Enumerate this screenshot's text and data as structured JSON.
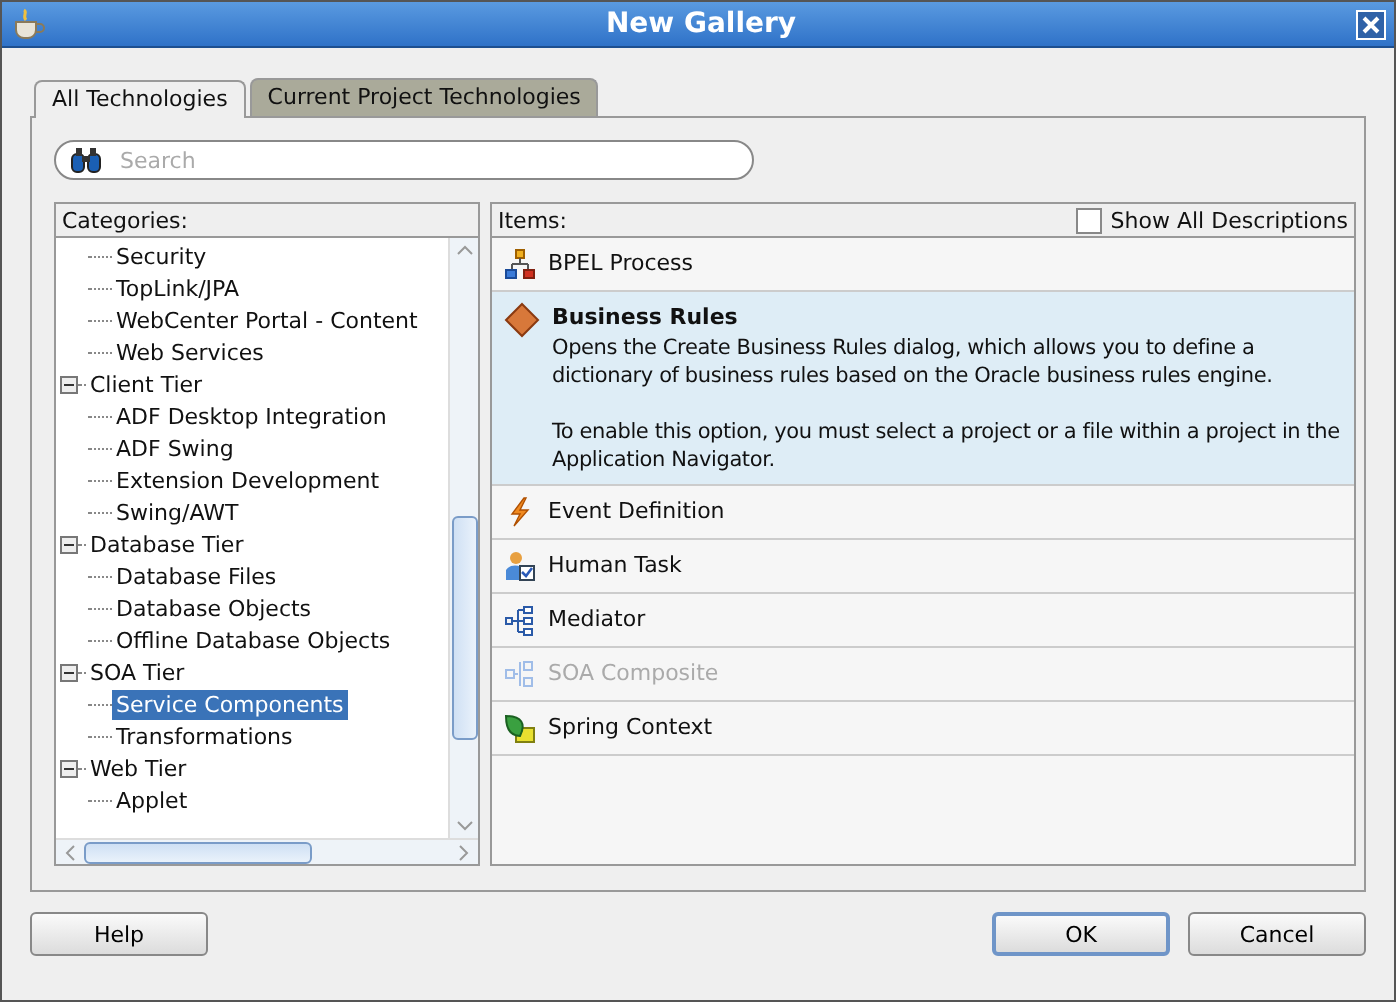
{
  "window": {
    "title": "New Gallery"
  },
  "tabs": [
    {
      "label": "All Technologies",
      "selected": true
    },
    {
      "label": "Current Project Technologies",
      "selected": false
    }
  ],
  "search": {
    "placeholder": "Search"
  },
  "categories": {
    "label": "Categories:",
    "tree": [
      {
        "children": [
          {
            "label": "Security",
            "selected": false
          },
          {
            "label": "TopLink/JPA",
            "selected": false
          },
          {
            "label": "WebCenter Portal - Content",
            "selected": false
          },
          {
            "label": "Web Services",
            "selected": false
          }
        ]
      },
      {
        "label": "Client Tier",
        "expanded": true,
        "selected": false,
        "children": [
          {
            "label": "ADF Desktop Integration",
            "selected": false
          },
          {
            "label": "ADF Swing",
            "selected": false
          },
          {
            "label": "Extension Development",
            "selected": false
          },
          {
            "label": "Swing/AWT",
            "selected": false
          }
        ]
      },
      {
        "label": "Database Tier",
        "expanded": true,
        "selected": false,
        "children": [
          {
            "label": "Database Files",
            "selected": false
          },
          {
            "label": "Database Objects",
            "selected": false
          },
          {
            "label": "Offline Database Objects",
            "selected": false
          }
        ]
      },
      {
        "label": "SOA Tier",
        "expanded": true,
        "selected": false,
        "children": [
          {
            "label": "Service Components",
            "selected": true
          },
          {
            "label": "Transformations",
            "selected": false
          }
        ]
      },
      {
        "label": "Web Tier",
        "expanded": true,
        "selected": false,
        "children": [
          {
            "label": "Applet",
            "selected": false
          }
        ]
      }
    ]
  },
  "items": {
    "label": "Items:",
    "show_all": {
      "label": "Show All Descriptions",
      "checked": false
    },
    "list": [
      {
        "kind": "bpel",
        "label": "BPEL Process",
        "selected": false,
        "disabled": false
      },
      {
        "kind": "rules",
        "label": "Business Rules",
        "selected": true,
        "disabled": false,
        "description": [
          "Opens the Create Business Rules dialog, which allows you to define a dictionary of business rules based on the Oracle business rules engine.",
          "To enable this option, you must select a project or a file within a project in the Application Navigator."
        ]
      },
      {
        "kind": "event",
        "label": "Event Definition",
        "selected": false,
        "disabled": false
      },
      {
        "kind": "human",
        "label": "Human Task",
        "selected": false,
        "disabled": false
      },
      {
        "kind": "mediator",
        "label": "Mediator",
        "selected": false,
        "disabled": false
      },
      {
        "kind": "composite",
        "label": "SOA Composite",
        "selected": false,
        "disabled": true
      },
      {
        "kind": "spring",
        "label": "Spring Context",
        "selected": false,
        "disabled": false
      }
    ]
  },
  "buttons": [
    {
      "label": "Help",
      "kind": "help"
    },
    {
      "label": "OK",
      "kind": "ok"
    },
    {
      "label": "Cancel",
      "kind": "cancel"
    }
  ]
}
